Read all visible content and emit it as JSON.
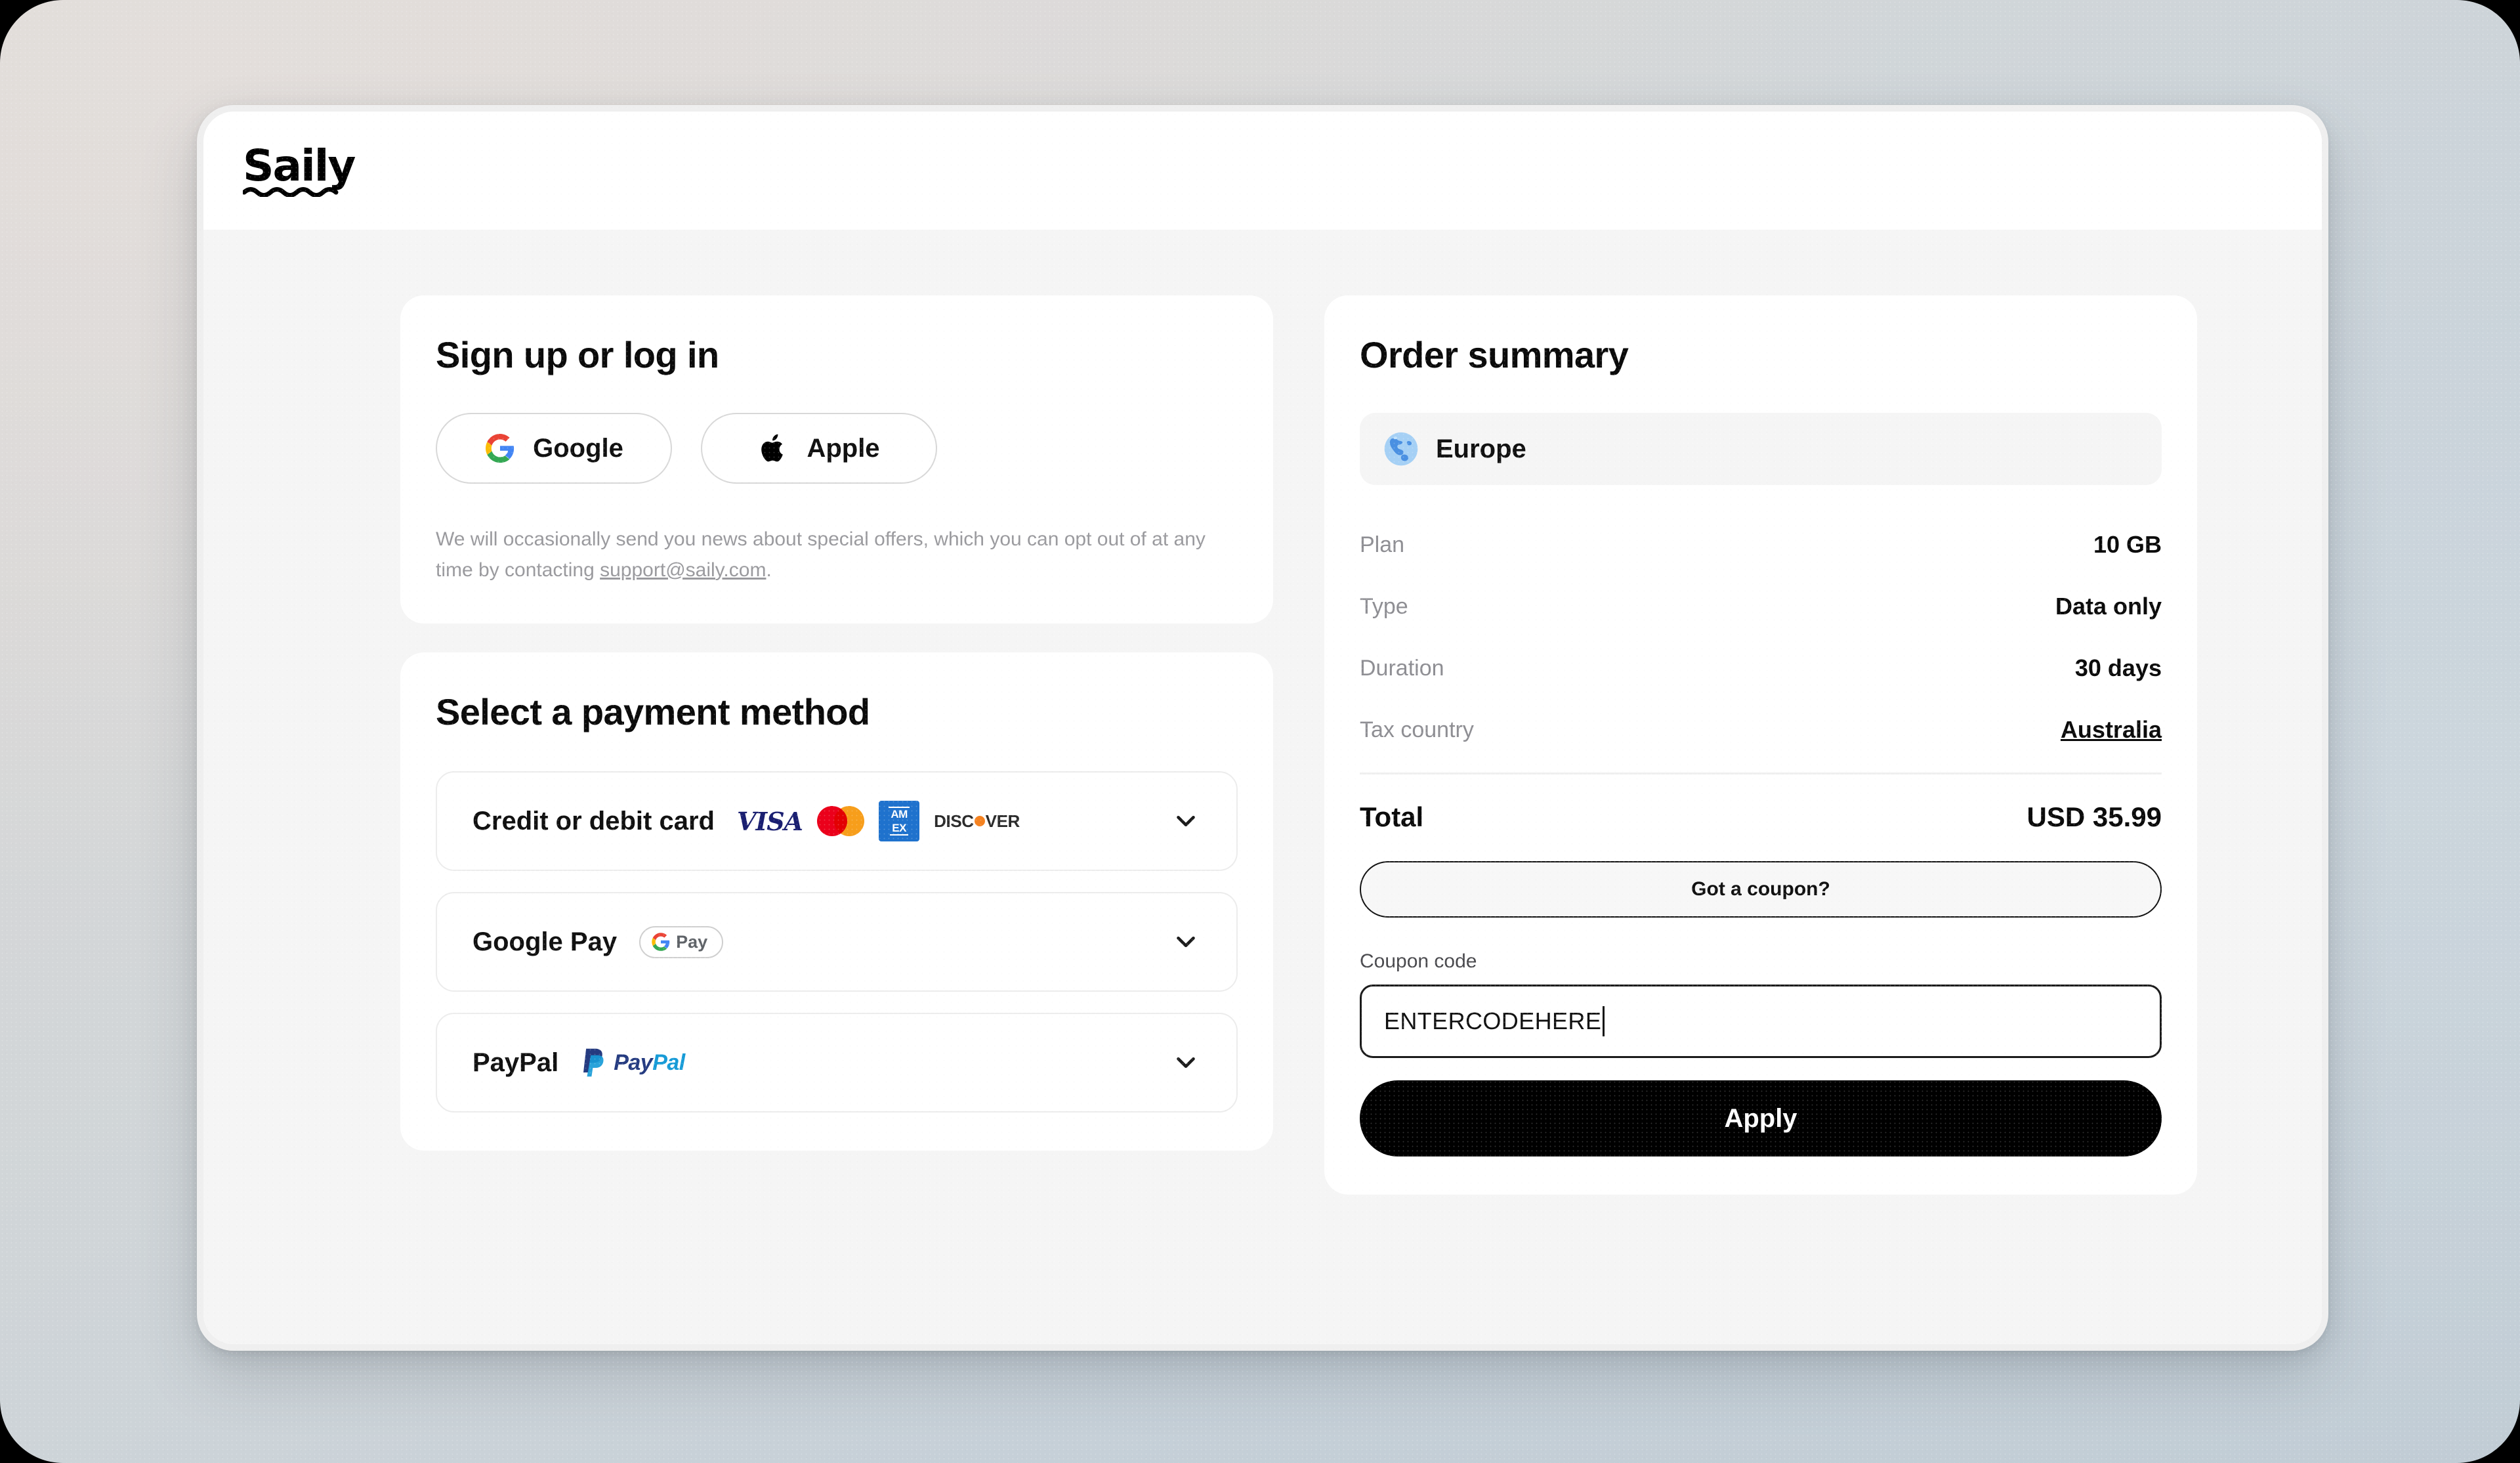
{
  "brand": {
    "name": "Saily",
    "logo_icon": "saily-wave-logo"
  },
  "auth": {
    "title": "Sign up or log in",
    "providers": [
      {
        "label": "Google",
        "icon": "google-icon"
      },
      {
        "label": "Apple",
        "icon": "apple-icon"
      }
    ],
    "disclaimer_before": "We will occasionally send you news about special offers, which you can opt out of at any time by contacting ",
    "disclaimer_link": "support@saily.com",
    "disclaimer_after": "."
  },
  "payment": {
    "title": "Select a payment method",
    "methods": [
      {
        "label": "Credit or debit card",
        "brands": [
          "visa",
          "mastercard",
          "amex",
          "discover"
        ],
        "chevron": "chevron-down-icon"
      },
      {
        "label": "Google Pay",
        "brands": [
          "gpay"
        ],
        "chevron": "chevron-down-icon"
      },
      {
        "label": "PayPal",
        "brands": [
          "paypal"
        ],
        "chevron": "chevron-down-icon"
      }
    ]
  },
  "order": {
    "title": "Order summary",
    "region": {
      "name": "Europe",
      "icon": "globe-icon"
    },
    "rows": [
      {
        "key": "Plan",
        "value": "10 GB",
        "is_link": false
      },
      {
        "key": "Type",
        "value": "Data only",
        "is_link": false
      },
      {
        "key": "Duration",
        "value": "30 days",
        "is_link": false
      },
      {
        "key": "Tax country",
        "value": "Australia",
        "is_link": true
      }
    ],
    "total_label": "Total",
    "total_value": "USD 35.99",
    "coupon_toggle_label": "Got a coupon?",
    "coupon_field_label": "Coupon code",
    "coupon_value": "ENTERCODEHERE",
    "coupon_placeholder": "Coupon code",
    "apply_label": "Apply"
  },
  "brand_marks": {
    "visa": "VISA",
    "discover_pre": "DISC",
    "discover_post": "VER",
    "gpay": "Pay",
    "amex_line1": "AM",
    "amex_line2": "EX",
    "paypal_a": "Pay",
    "paypal_b": "Pal"
  },
  "colors": {
    "accent": "#000000",
    "page_bg": "#f5f5f5",
    "card_bg": "#ffffff",
    "muted_text": "#8e8e93",
    "visa": "#1a1f71",
    "mastercard_left": "#eb001b",
    "mastercard_right": "#f79e1b",
    "amex": "#1f72cd",
    "discover": "#f58220",
    "paypal_dark": "#253b80",
    "paypal_light": "#179bd7"
  }
}
